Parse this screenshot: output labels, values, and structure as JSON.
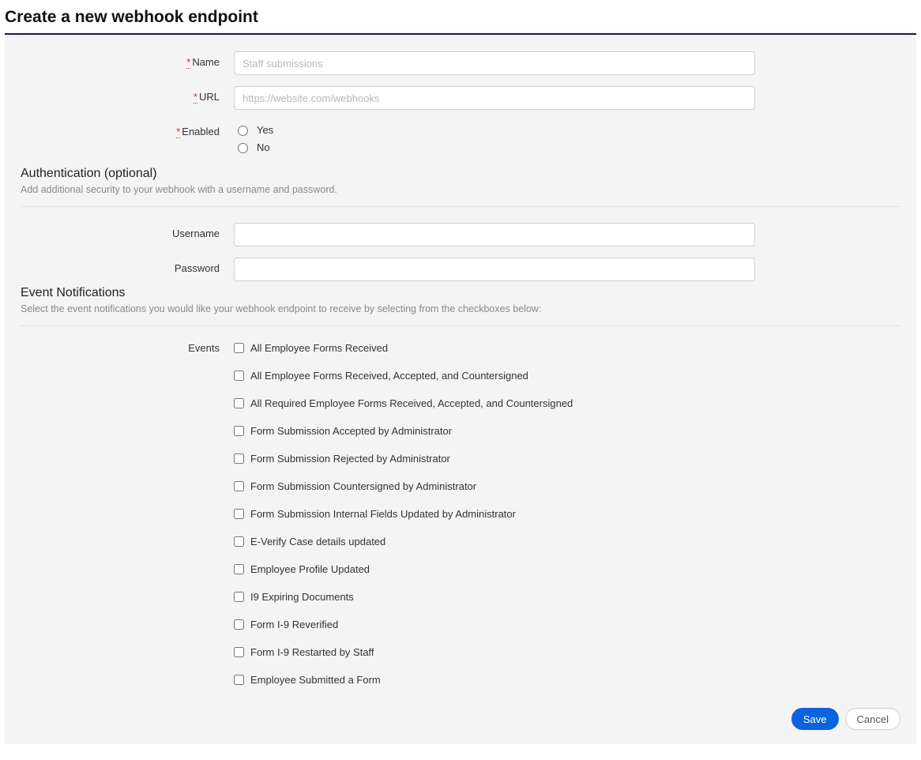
{
  "title": "Create a new webhook endpoint",
  "required_marker": "*",
  "fields": {
    "name": {
      "label": "Name",
      "placeholder": "Staff submissions",
      "value": ""
    },
    "url": {
      "label": "URL",
      "placeholder": "https://website.com/webhooks",
      "value": ""
    },
    "enabled": {
      "label": "Enabled",
      "options": {
        "yes": "Yes",
        "no": "No"
      }
    },
    "username": {
      "label": "Username",
      "value": ""
    },
    "password": {
      "label": "Password",
      "value": ""
    },
    "events_label": "Events"
  },
  "sections": {
    "auth": {
      "heading": "Authentication (optional)",
      "sub": "Add additional security to your webhook with a username and password."
    },
    "events": {
      "heading": "Event Notifications",
      "sub": "Select the event notifications you would like your webhook endpoint to receive by selecting from the checkboxes below:"
    }
  },
  "events": [
    "All Employee Forms Received",
    "All Employee Forms Received, Accepted, and Countersigned",
    "All Required Employee Forms Received, Accepted, and Countersigned",
    "Form Submission Accepted by Administrator",
    "Form Submission Rejected by Administrator",
    "Form Submission Countersigned by Administrator",
    "Form Submission Internal Fields Updated by Administrator",
    "E-Verify Case details updated",
    "Employee Profile Updated",
    "I9 Expiring Documents",
    "Form I-9 Reverified",
    "Form I-9 Restarted by Staff",
    "Employee Submitted a Form"
  ],
  "buttons": {
    "save": "Save",
    "cancel": "Cancel"
  }
}
